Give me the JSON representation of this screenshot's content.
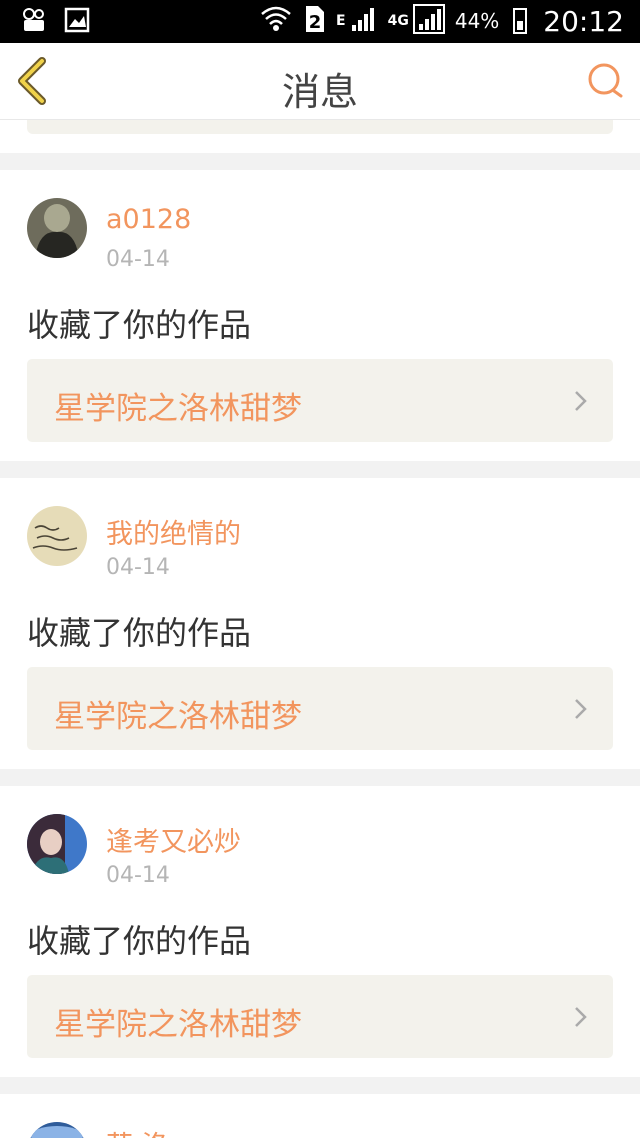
{
  "status_bar": {
    "battery_percent": "44%",
    "time": "20:12",
    "sim_number": "2",
    "net_edge": "E",
    "net_4g": "4G"
  },
  "header": {
    "title": "消息"
  },
  "notifications": [
    {
      "username": "a0128",
      "date": "04-14",
      "action": "收藏了你的作品",
      "work_title": "星学院之洛林甜梦",
      "avatar_colors": [
        "#5e5b4c",
        "#262622",
        "#a9a890"
      ]
    },
    {
      "username": "我的绝情的",
      "date": "04-14",
      "action": "收藏了你的作品",
      "work_title": "星学院之洛林甜梦",
      "avatar_colors": [
        "#e6dcb8",
        "#d4c79a",
        "#4a4436"
      ]
    },
    {
      "username": "逢考又必炒",
      "date": "04-14",
      "action": "收藏了你的作品",
      "work_title": "星学院之洛林甜梦",
      "avatar_colors": [
        "#3b2b3a",
        "#2d6f77",
        "#3f78c9"
      ]
    },
    {
      "username": "莯·洛",
      "avatar_colors": [
        "#2f5c9a",
        "#8bb3e6"
      ]
    }
  ],
  "colors": {
    "accent": "#f2955e",
    "text": "#333333",
    "muted": "#b5b5b5",
    "work_bg": "#f3f2ec",
    "page_bg": "#f2f2f2"
  }
}
